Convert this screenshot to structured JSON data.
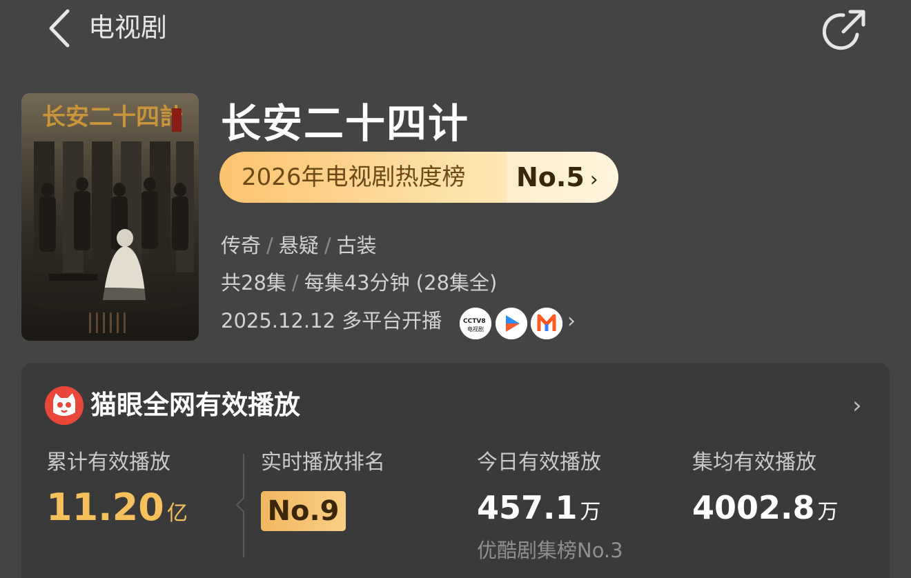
{
  "header": {
    "title": "电视剧",
    "back_icon": "chevron-left-icon",
    "share_icon": "share-icon"
  },
  "show": {
    "title": "长安二十四计",
    "poster_text": "长安二十四計",
    "rank": {
      "label": "2026年电视剧热度榜",
      "value": "No.5",
      "chevron": "›"
    },
    "genres": [
      "传奇",
      "悬疑",
      "古装"
    ],
    "episodes": {
      "total": "共28集",
      "detail": "每集43分钟 (28集全)"
    },
    "release": {
      "date": "2025.12.12",
      "text": "多平台开播",
      "chevron": "›"
    },
    "platforms": [
      {
        "name": "CCTV8",
        "label": "CCTV8",
        "sub": "电视剧"
      },
      {
        "name": "youku",
        "label": ""
      },
      {
        "name": "mango",
        "label": "M"
      }
    ]
  },
  "maoyan": {
    "title": "猫眼全网有效播放",
    "chevron": "›",
    "stats": [
      {
        "label": "累计有效播放",
        "value": "11.20",
        "unit": "亿"
      },
      {
        "label": "实时播放排名",
        "value": "No.9"
      },
      {
        "label": "今日有效播放",
        "value": "457.1",
        "unit": "万",
        "sub": "优酷剧集榜No.3"
      },
      {
        "label": "集均有效播放",
        "value": "4002.8",
        "unit": "万"
      }
    ]
  },
  "colors": {
    "background": "#444444",
    "card": "#3a3a3a",
    "gold": "#f6c15c",
    "maoyan_red": "#e8473a"
  }
}
